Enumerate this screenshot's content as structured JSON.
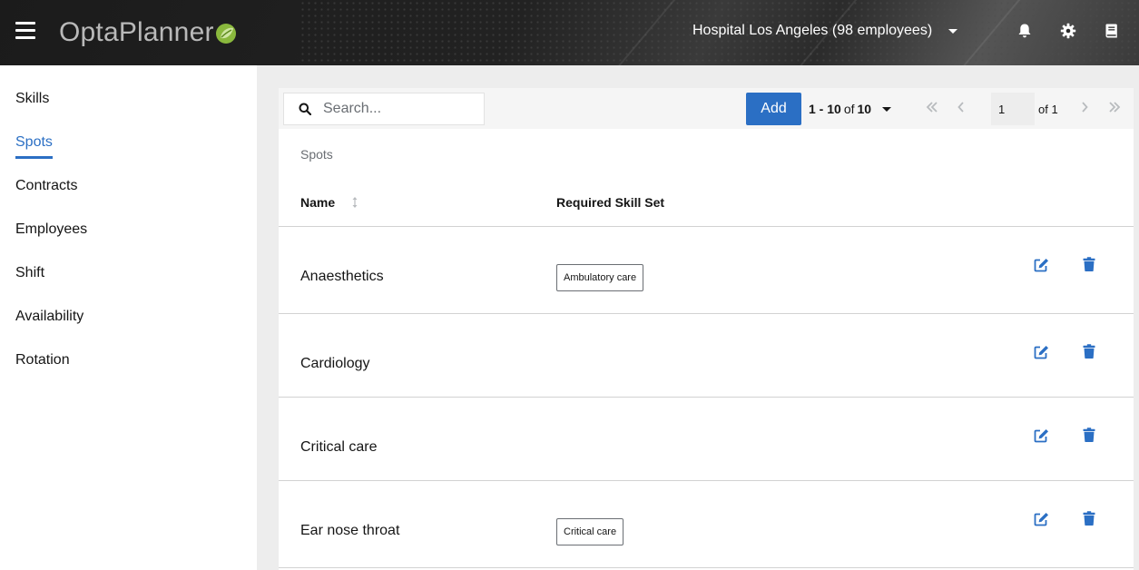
{
  "header": {
    "logo_text": "OptaPlanner",
    "tenant": "Hospital Los Angeles (98 employees)",
    "icons": [
      "menu-icon",
      "bell-icon",
      "gear-icon",
      "book-icon"
    ]
  },
  "sidebar": {
    "items": [
      {
        "label": "Skills",
        "active": false
      },
      {
        "label": "Spots",
        "active": true
      },
      {
        "label": "Contracts",
        "active": false
      },
      {
        "label": "Employees",
        "active": false
      },
      {
        "label": "Shift",
        "active": false
      },
      {
        "label": "Availability",
        "active": false
      },
      {
        "label": "Rotation",
        "active": false
      }
    ]
  },
  "toolbar": {
    "search_placeholder": "Search...",
    "add_label": "Add",
    "range": "1 - 10",
    "of_word": "of",
    "total": "10",
    "page": "1",
    "of_pages": "of 1"
  },
  "table": {
    "caption": "Spots",
    "columns": [
      "Name",
      "Required Skill Set"
    ],
    "rows": [
      {
        "name": "Anaesthetics",
        "skills": [
          "Ambulatory care"
        ]
      },
      {
        "name": "Cardiology",
        "skills": []
      },
      {
        "name": "Critical care",
        "skills": []
      },
      {
        "name": "Ear nose throat",
        "skills": [
          "Critical care"
        ]
      }
    ]
  },
  "colors": {
    "accent": "#2b6fc4",
    "header_bg": "#222222",
    "sidebar_bg": "#ffffff"
  }
}
